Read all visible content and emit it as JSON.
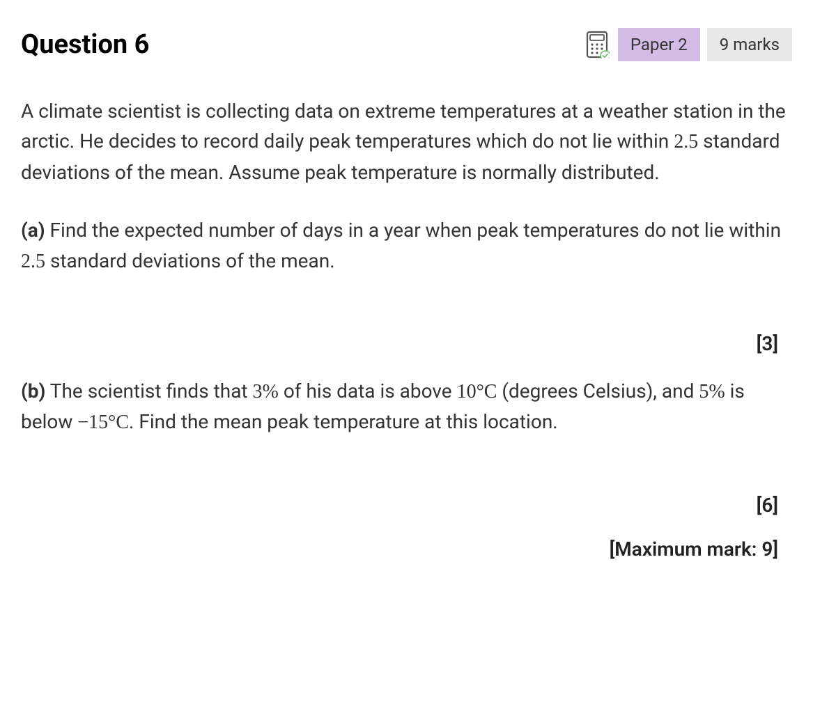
{
  "header": {
    "title": "Question 6",
    "paper_badge": "Paper 2",
    "marks_badge": "9 marks"
  },
  "intro": {
    "text_1": "A climate scientist is collecting data on extreme temperatures at a weather station in the arctic. He decides to record daily peak temperatures which do not lie within ",
    "val_1": "2.5",
    "text_2": " standard deviations of the mean. Assume peak temperature is normally distributed."
  },
  "part_a": {
    "label": "(a)",
    "text_1": " Find the expected number of days in a year when peak temperatures do not lie within ",
    "val_1": "2.5",
    "text_2": " standard deviations of the mean.",
    "marks": "[3]"
  },
  "part_b": {
    "label": "(b)",
    "text_1": " The scientist finds that ",
    "val_1": "3%",
    "text_2": " of his data is above ",
    "val_2": "10",
    "unit_2": "°C",
    "text_3": " (degrees Celsius), and ",
    "val_3": "5%",
    "text_4": " is below ",
    "val_4": "−15",
    "unit_4": "°C",
    "text_5": ". Find the mean peak temperature at this location.",
    "marks": "[6]"
  },
  "max_mark": "[Maximum mark: 9]"
}
